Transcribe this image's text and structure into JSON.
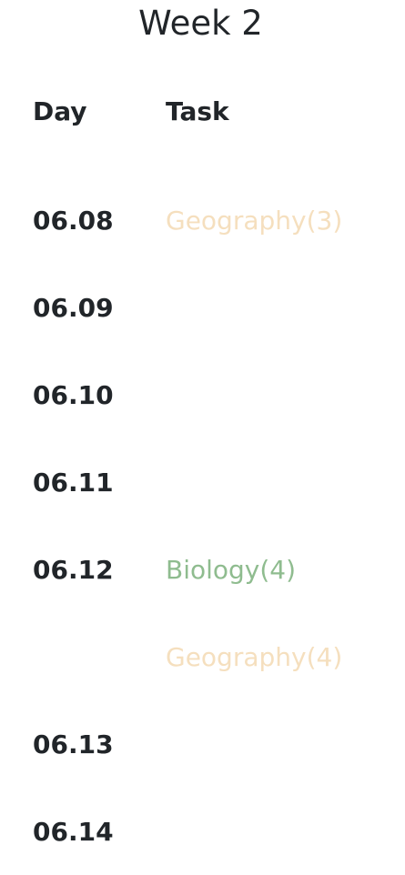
{
  "title": "Week 2",
  "columns": {
    "day": "Day",
    "task": "Task"
  },
  "rows": [
    {
      "day": "06.08",
      "task": "Geography(3)",
      "task_color": "#f5dfbe"
    },
    {
      "day": "06.09",
      "task": "",
      "task_color": ""
    },
    {
      "day": "06.10",
      "task": "",
      "task_color": ""
    },
    {
      "day": "06.11",
      "task": "",
      "task_color": ""
    },
    {
      "day": "06.12",
      "task": "Biology(4)",
      "task_color": "#8fbc8f"
    },
    {
      "day": "",
      "task": "Geography(4)",
      "task_color": "#f5dfbe"
    },
    {
      "day": "06.13",
      "task": "",
      "task_color": ""
    },
    {
      "day": "06.14",
      "task": "",
      "task_color": ""
    }
  ],
  "colors": {
    "text": "#212529",
    "geography": "#f5dfbe",
    "biology": "#8fbc8f"
  }
}
